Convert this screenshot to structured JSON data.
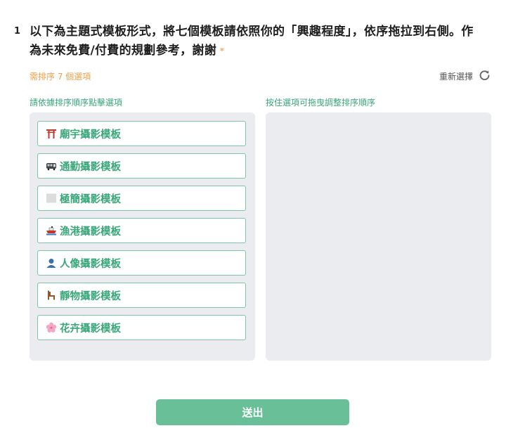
{
  "question": {
    "number": "1",
    "text": "以下為主題式模板形式，將七個模板請依照你的「興趣程度」，依序拖拉到右側。作為未來免費/付費的規劃參考，謝謝",
    "required_mark": "*"
  },
  "ranking": {
    "need_text": "需排序 7 個選項",
    "reset_label": "重新選擇",
    "left_label": "請依據排序順序點擊選項",
    "right_label": "按住選項可拖曳調整排序順序",
    "options": [
      {
        "label": "廟宇攝影模板",
        "icon": "torii-gate-icon"
      },
      {
        "label": "通勤攝影模板",
        "icon": "train-icon"
      },
      {
        "label": "極簡攝影模板",
        "icon": "white-square-icon"
      },
      {
        "label": "漁港攝影模板",
        "icon": "ship-icon"
      },
      {
        "label": "人像攝影模板",
        "icon": "person-silhouette-icon"
      },
      {
        "label": "靜物攝影模板",
        "icon": "chair-icon"
      },
      {
        "label": "花卉攝影模板",
        "icon": "cherry-blossom-icon"
      }
    ]
  },
  "submit": {
    "label": "送出"
  },
  "colors": {
    "accent": "#3aa77a",
    "button": "#69bf97",
    "warning": "#f0a048",
    "panel": "#ebecef"
  }
}
